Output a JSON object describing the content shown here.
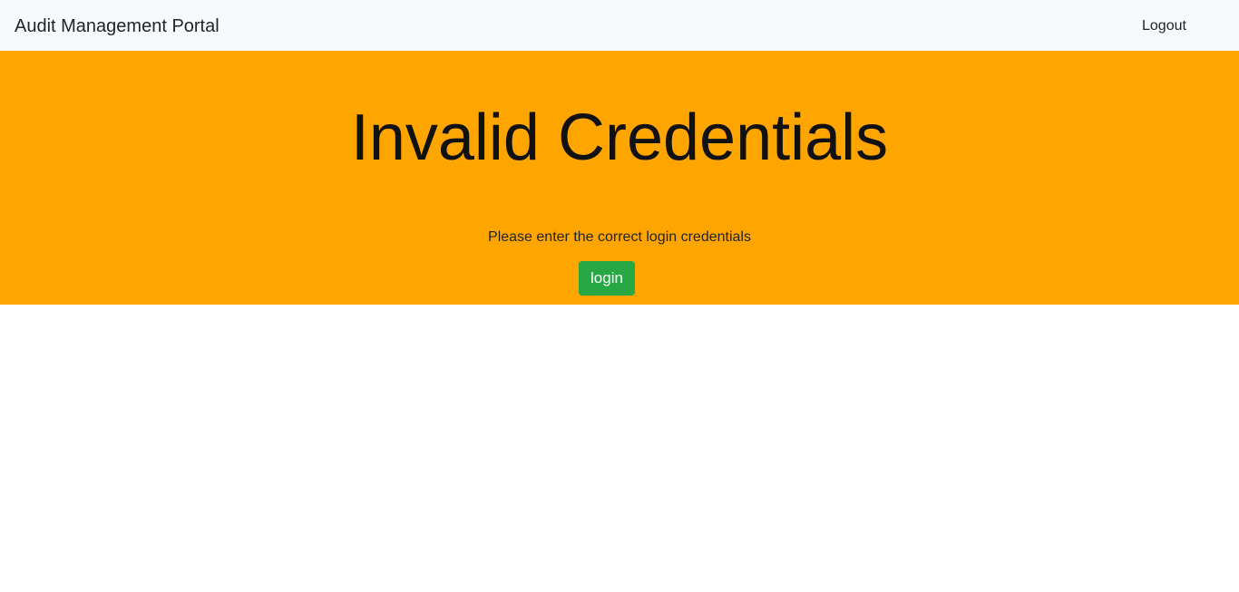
{
  "navbar": {
    "brand": "Audit Management Portal",
    "logout_label": "Logout",
    "background": "#f8f9fa"
  },
  "hero": {
    "title": "Invalid Credentials",
    "message": "Please enter the correct login credentials",
    "login_label": "login",
    "background": "#ffa500",
    "button_color": "#28a745"
  }
}
